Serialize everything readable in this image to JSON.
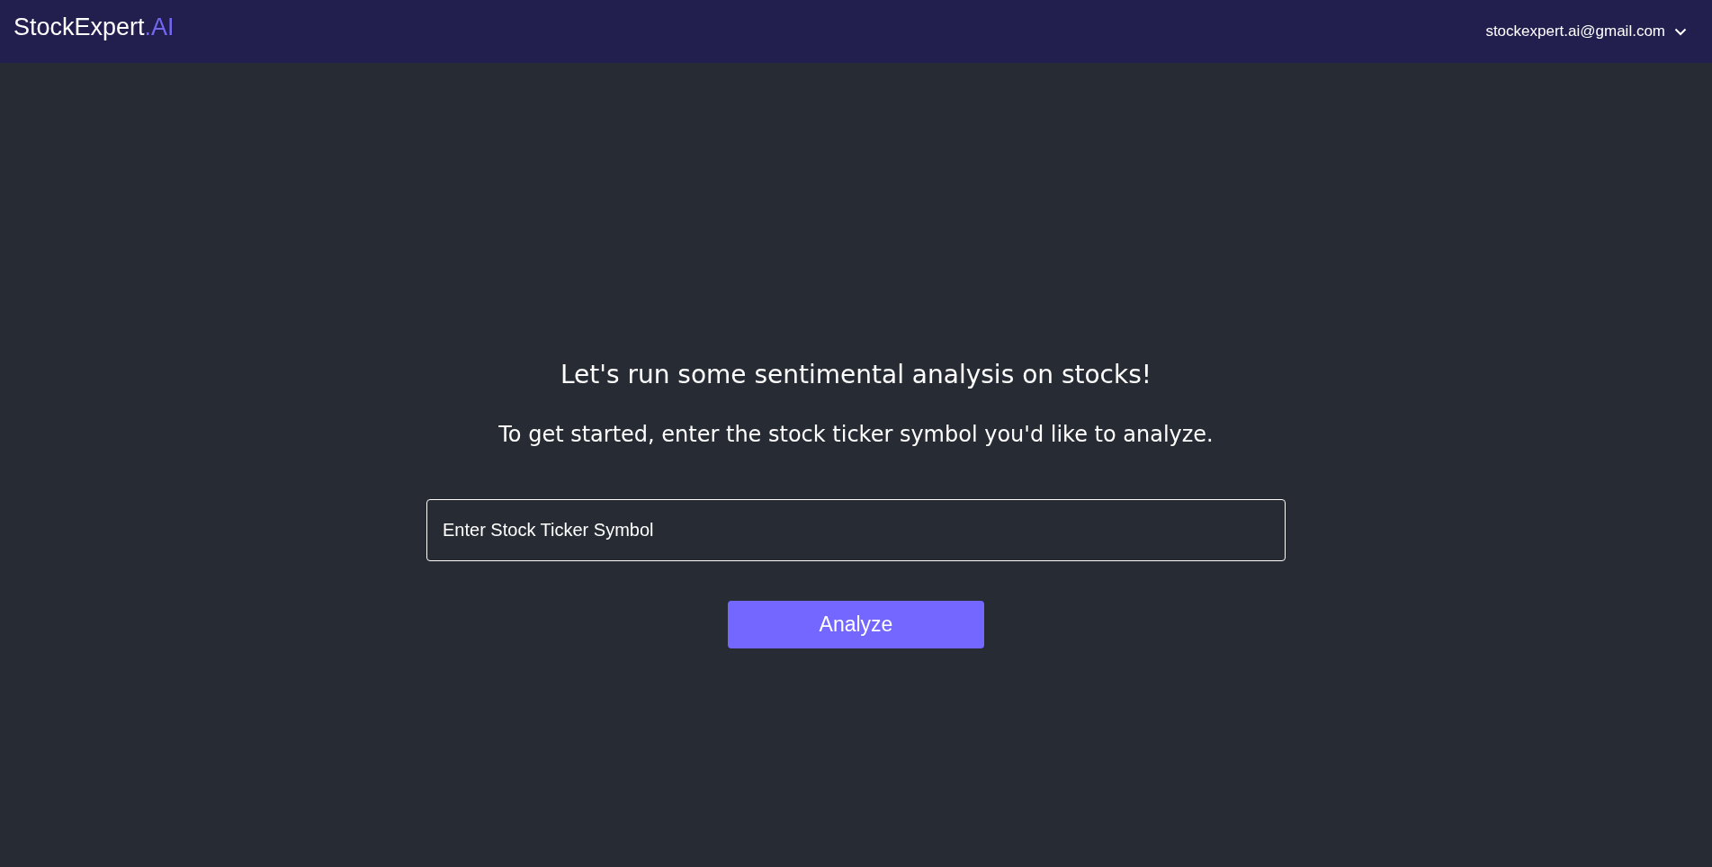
{
  "header": {
    "logo": {
      "name": "StockExpert",
      "suffix": ".AI"
    },
    "account": {
      "email": "stockexpert.ai@gmail.com",
      "expanded": false
    }
  },
  "main": {
    "heading": "Let's run some sentimental analysis on stocks!",
    "subheading": "To get started, enter the stock ticker symbol you'd like to analyze.",
    "ticker_field": {
      "placeholder": "Enter Stock Ticker Symbol"
    },
    "button": "Analyze"
  }
}
